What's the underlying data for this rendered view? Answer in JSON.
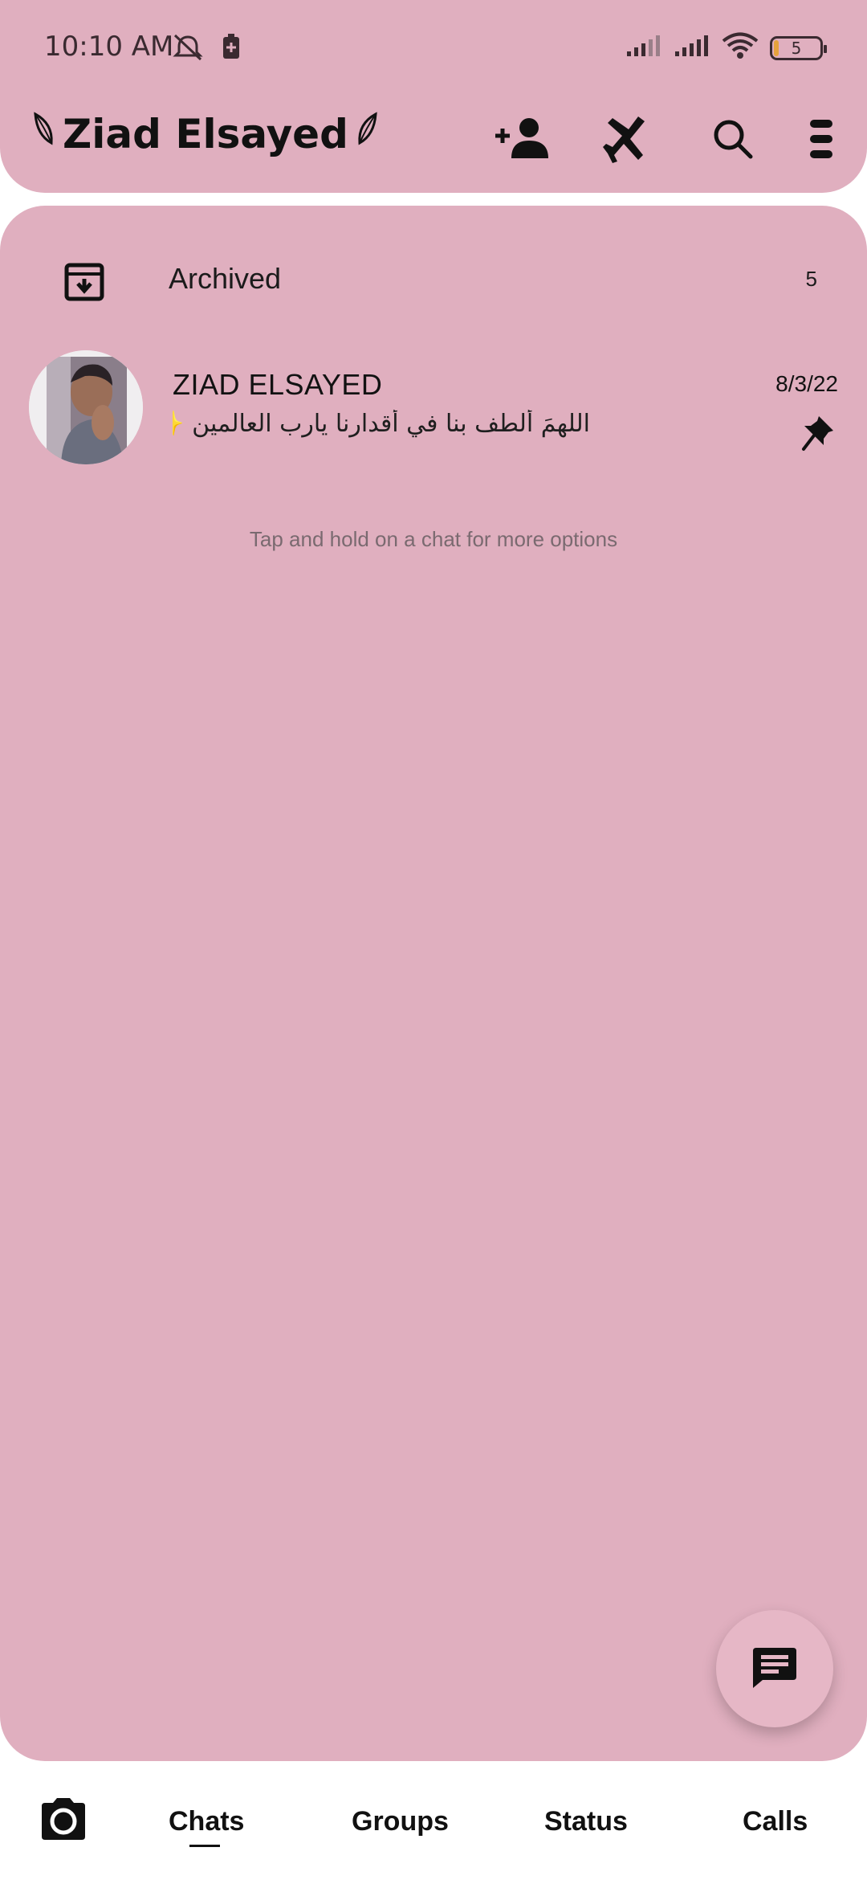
{
  "status_bar": {
    "time": "10:10 AM",
    "battery_level": "5",
    "icons": [
      "mute-notifications-icon",
      "battery-saver-icon",
      "signal-icon",
      "signal-icon",
      "wifi-icon",
      "battery-icon"
    ]
  },
  "header": {
    "title": "Ziad Elsayed",
    "actions": [
      "add-contact-icon",
      "plane-icon",
      "search-icon",
      "menu-icon"
    ]
  },
  "archived": {
    "label": "Archived",
    "count": "5"
  },
  "chats": [
    {
      "name": "ZIAD ELSAYED",
      "date": "8/3/22",
      "preview": "اللهمَ ألطف بنا في أقدارنا يارب العالمين ✨.",
      "pinned": true
    }
  ],
  "hint": "Tap and hold on a chat for more options",
  "bottom_nav": {
    "tabs": [
      "Chats",
      "Groups",
      "Status",
      "Calls"
    ],
    "active": "Chats"
  },
  "colors": {
    "accent_pink": "#e0afbf",
    "text_dark": "#111111",
    "hint_gray": "#7a6a70"
  }
}
